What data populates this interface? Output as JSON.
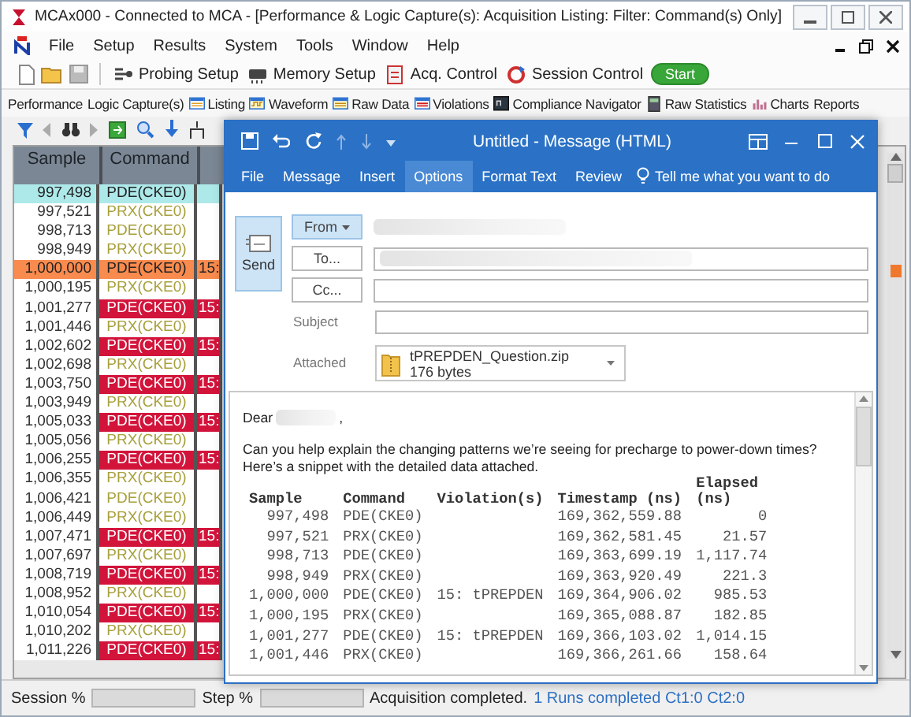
{
  "window": {
    "title": "MCAx000 - Connected to MCA - [Performance & Logic Capture(s): Acquisition Listing: Filter: Command(s) Only]"
  },
  "menu": [
    "File",
    "Setup",
    "Results",
    "System",
    "Tools",
    "Window",
    "Help"
  ],
  "toolbar": [
    {
      "label": "Probing Setup"
    },
    {
      "label": "Memory Setup"
    },
    {
      "label": "Acq. Control"
    },
    {
      "label": "Session Control"
    }
  ],
  "start_button": "Start",
  "views": [
    {
      "label": "Performance",
      "kind": "text"
    },
    {
      "label": "Logic Capture(s)",
      "kind": "text"
    },
    {
      "label": "Listing",
      "kind": "icon"
    },
    {
      "label": "Waveform",
      "kind": "icon"
    },
    {
      "label": "Raw Data",
      "kind": "icon"
    },
    {
      "label": "Violations",
      "kind": "icon"
    },
    {
      "label": "Compliance Navigator",
      "kind": "icon"
    },
    {
      "label": "Raw Statistics",
      "kind": "icon"
    },
    {
      "label": "Charts",
      "kind": "icon"
    },
    {
      "label": "Reports",
      "kind": "text"
    }
  ],
  "listing": {
    "columns": [
      "Sample",
      "Command"
    ],
    "rows": [
      {
        "sample": "997,498",
        "command": "PDE(CKE0)",
        "selected": true,
        "marked": false,
        "violation": false
      },
      {
        "sample": "997,521",
        "command": "PRX(CKE0)",
        "selected": false,
        "marked": false,
        "violation": false
      },
      {
        "sample": "998,713",
        "command": "PDE(CKE0)",
        "selected": false,
        "marked": false,
        "violation": false
      },
      {
        "sample": "998,949",
        "command": "PRX(CKE0)",
        "selected": false,
        "marked": false,
        "violation": false
      },
      {
        "sample": "1,000,000",
        "command": "PDE(CKE0)",
        "column_3": "15:",
        "selected": false,
        "marked": true,
        "violation": true
      },
      {
        "sample": "1,000,195",
        "command": "PRX(CKE0)",
        "selected": false,
        "marked": false,
        "violation": false
      },
      {
        "sample": "1,001,277",
        "command": "PDE(CKE0)",
        "column_3": "15:",
        "selected": false,
        "marked": false,
        "violation": true
      },
      {
        "sample": "1,001,446",
        "command": "PRX(CKE0)",
        "selected": false,
        "marked": false,
        "violation": false
      },
      {
        "sample": "1,002,602",
        "command": "PDE(CKE0)",
        "column_3": "15:",
        "selected": false,
        "marked": false,
        "violation": true
      },
      {
        "sample": "1,002,698",
        "command": "PRX(CKE0)",
        "selected": false,
        "marked": false,
        "violation": false
      },
      {
        "sample": "1,003,750",
        "command": "PDE(CKE0)",
        "column_3": "15:",
        "selected": false,
        "marked": false,
        "violation": true
      },
      {
        "sample": "1,003,949",
        "command": "PRX(CKE0)",
        "selected": false,
        "marked": false,
        "violation": false
      },
      {
        "sample": "1,005,033",
        "command": "PDE(CKE0)",
        "column_3": "15:",
        "selected": false,
        "marked": false,
        "violation": true
      },
      {
        "sample": "1,005,056",
        "command": "PRX(CKE0)",
        "selected": false,
        "marked": false,
        "violation": false
      },
      {
        "sample": "1,006,255",
        "command": "PDE(CKE0)",
        "column_3": "15:",
        "selected": false,
        "marked": false,
        "violation": true
      },
      {
        "sample": "1,006,355",
        "command": "PRX(CKE0)",
        "selected": false,
        "marked": false,
        "violation": false
      },
      {
        "sample": "1,006,421",
        "command": "PDE(CKE0)",
        "selected": false,
        "marked": false,
        "violation": false
      },
      {
        "sample": "1,006,449",
        "command": "PRX(CKE0)",
        "selected": false,
        "marked": false,
        "violation": false
      },
      {
        "sample": "1,007,471",
        "command": "PDE(CKE0)",
        "column_3": "15:",
        "selected": false,
        "marked": false,
        "violation": true
      },
      {
        "sample": "1,007,697",
        "command": "PRX(CKE0)",
        "selected": false,
        "marked": false,
        "violation": false
      },
      {
        "sample": "1,008,719",
        "command": "PDE(CKE0)",
        "column_3": "15:",
        "selected": false,
        "marked": false,
        "violation": true
      },
      {
        "sample": "1,008,952",
        "command": "PRX(CKE0)",
        "selected": false,
        "marked": false,
        "violation": false
      },
      {
        "sample": "1,010,054",
        "command": "PDE(CKE0)",
        "column_3": "15:",
        "selected": false,
        "marked": false,
        "violation": true
      },
      {
        "sample": "1,010,202",
        "command": "PRX(CKE0)",
        "selected": false,
        "marked": false,
        "violation": false
      },
      {
        "sample": "1,011,226",
        "command": "PDE(CKE0)",
        "column_3": "15:",
        "selected": false,
        "marked": false,
        "violation": true
      }
    ]
  },
  "email": {
    "title": "Untitled - Message (HTML)",
    "ribbon_tabs": [
      {
        "label": "File",
        "selected": false
      },
      {
        "label": "Message",
        "selected": false
      },
      {
        "label": "Insert",
        "selected": false
      },
      {
        "label": "Options",
        "selected": true
      },
      {
        "label": "Format Text",
        "selected": false
      },
      {
        "label": "Review",
        "selected": false
      }
    ],
    "tell_me": "Tell me what you want to do",
    "send": "Send",
    "from": "From",
    "to": "To...",
    "cc": "Cc...",
    "subject_label": "Subject",
    "attached_label": "Attached",
    "attachment": {
      "name": "tPREPDEN_Question.zip",
      "size": "176 bytes"
    },
    "greeting": "Dear",
    "greeting_end": ",",
    "paragraph": [
      "Can you help explain the changing patterns we’re seeing for precharge to power-down times?",
      "Here’s a snippet with the detailed data attached."
    ],
    "table": {
      "columns": [
        "Sample",
        "Command",
        "Violation(s)",
        "Timestamp (ns)",
        "Elapsed (ns)"
      ],
      "rows": [
        {
          "sample": "997,498",
          "command": "PDE(CKE0)",
          "timestamp": "169,362,559.88",
          "elapsed": "0"
        },
        {
          "sample": "997,521",
          "command": "PRX(CKE0)",
          "timestamp": "169,362,581.45",
          "elapsed": "21.57"
        },
        {
          "sample": "998,713",
          "command": "PDE(CKE0)",
          "timestamp": "169,363,699.19",
          "elapsed": "1,117.74"
        },
        {
          "sample": "998,949",
          "command": "PRX(CKE0)",
          "timestamp": "169,363,920.49",
          "elapsed": "221.3"
        },
        {
          "sample": "1,000,000",
          "command": "PDE(CKE0)",
          "violation": "15: tPREPDEN",
          "timestamp": "169,364,906.02",
          "elapsed": "985.53"
        },
        {
          "sample": "1,000,195",
          "command": "PRX(CKE0)",
          "timestamp": "169,365,088.87",
          "elapsed": "182.85"
        },
        {
          "sample": "1,001,277",
          "command": "PDE(CKE0)",
          "violation": "15: tPREPDEN",
          "timestamp": "169,366,103.02",
          "elapsed": "1,014.15"
        },
        {
          "sample": "1,001,446",
          "command": "PRX(CKE0)",
          "timestamp": "169,366,261.66",
          "elapsed": "158.64"
        }
      ]
    }
  },
  "status_bar": {
    "session": {
      "label": "Session %",
      "level": 0
    },
    "step": {
      "label": "Step %",
      "level": 0
    },
    "message": "Acquisition completed.",
    "runs": "1 Runs completed Ct1:0 Ct2:0"
  }
}
